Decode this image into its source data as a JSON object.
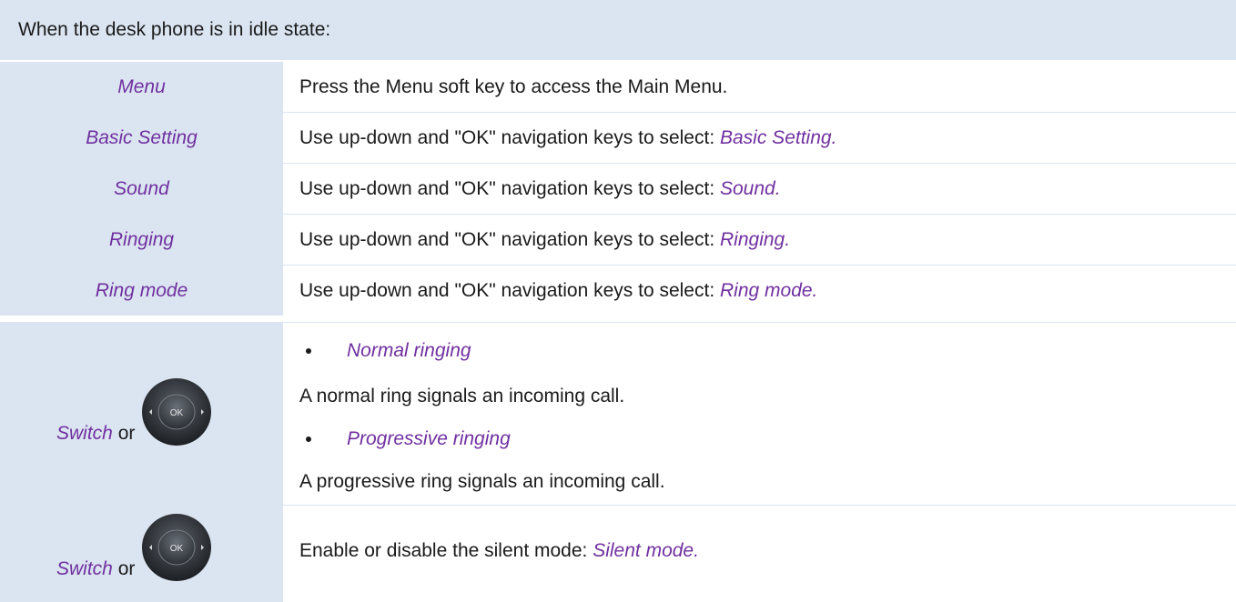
{
  "header": {
    "text": "When the desk phone is in idle state:"
  },
  "rows": [
    {
      "left": "Menu",
      "right_text": "Press the Menu soft key to access the Main Menu.",
      "right_kw": ""
    },
    {
      "left": "Basic Setting",
      "right_text": "Use up-down and \"OK\" navigation keys to select: ",
      "right_kw": "Basic Setting."
    },
    {
      "left": "Sound",
      "right_text": "Use up-down and \"OK\" navigation keys to select: ",
      "right_kw": "Sound."
    },
    {
      "left": "Ringing",
      "right_text": "Use up-down and \"OK\" navigation keys to select: ",
      "right_kw": "Ringing."
    },
    {
      "left": "Ring mode",
      "right_text": "Use up-down and \"OK\" navigation keys to select: ",
      "right_kw": "Ring mode."
    }
  ],
  "ring_row": {
    "left_kw": "Switch",
    "left_or": " or",
    "bullet1": "Normal ringing",
    "desc1": "A normal ring signals an incoming call.",
    "bullet2": "Progressive ringing",
    "desc2": "A progressive ring signals an incoming call."
  },
  "silent_row": {
    "left_kw": "Switch",
    "left_or": " or",
    "right_text": "Enable or disable the silent mode: ",
    "right_kw": "Silent mode."
  },
  "ok_button": {
    "label": "OK",
    "icon": "navigation-ok-key-icon"
  },
  "colors": {
    "accent": "#7030a0",
    "panel": "#dbe5f1"
  }
}
